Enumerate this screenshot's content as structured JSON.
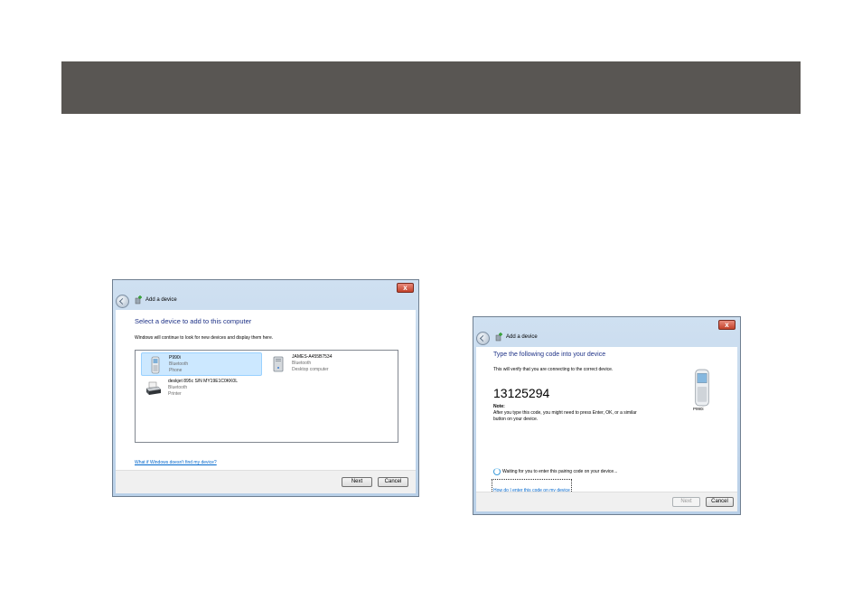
{
  "dialog1": {
    "title": "Add a device",
    "heading": "Select a device to add to this computer",
    "subtext": "Windows will continue to look for new devices and display them here.",
    "devices": [
      {
        "name": "P990i",
        "type": "Bluetooth",
        "category": "Phone",
        "icon": "phone-icon",
        "selected": true
      },
      {
        "name": "JAMES-A455B7534",
        "type": "Bluetooth",
        "category": "Desktop computer",
        "icon": "desktop-computer-icon",
        "selected": false
      },
      {
        "name": "deskjet 895c S/N MY19E1C0KK0L",
        "type": "Bluetooth",
        "category": "Printer",
        "icon": "printer-icon",
        "selected": false
      }
    ],
    "help_link": "What if Windows doesn't find my device?",
    "next_label": "Next",
    "cancel_label": "Cancel",
    "close_label": "x"
  },
  "dialog2": {
    "title": "Add a device",
    "heading": "Type the following code into your device",
    "subtext": "This will verify that you are connecting to the correct device.",
    "code": "13125294",
    "note_label": "Note:",
    "note_text_1": "After you type this code, you might need to press Enter, OK, or a similar",
    "note_text_2": "button on your device.",
    "device_name": "P990i",
    "waiting_text": "Waiting for you to enter this pairing code on your device...",
    "help_link": "How do I enter this code on my device",
    "next_label": "Next",
    "cancel_label": "Cancel",
    "close_label": "x"
  },
  "colors": {
    "banner": "#595653",
    "heading": "#1e3287",
    "link": "#0066cc",
    "selection": "#cce8ff"
  }
}
